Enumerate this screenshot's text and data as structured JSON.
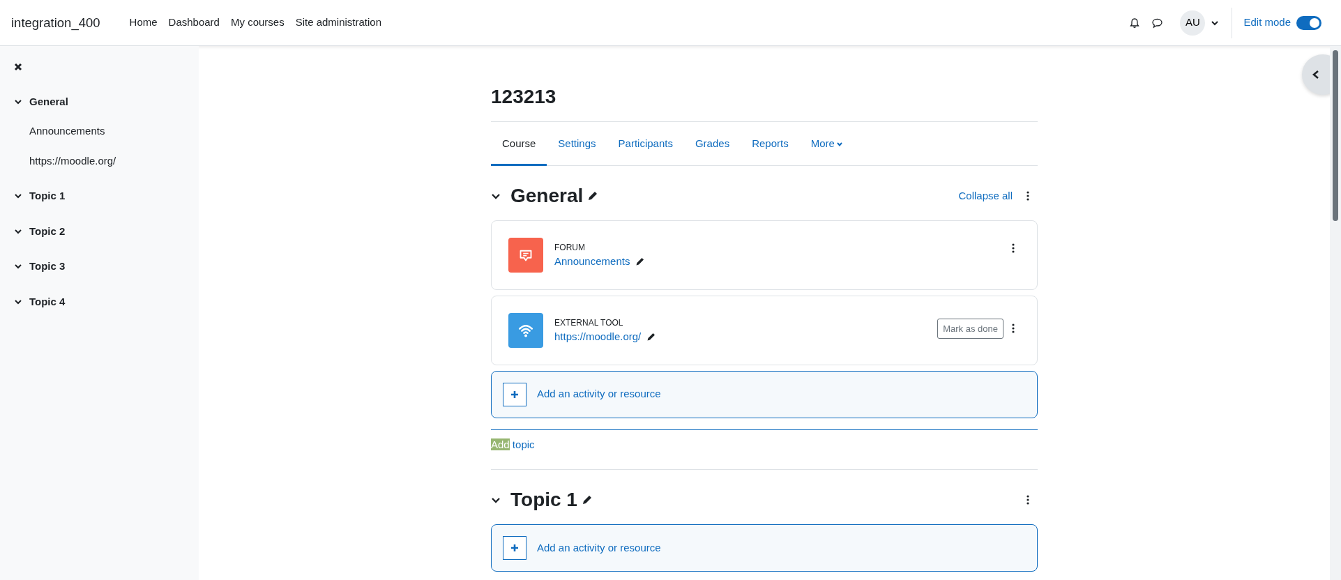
{
  "navbar": {
    "brand": "integration_400",
    "links": [
      "Home",
      "Dashboard",
      "My courses",
      "Site administration"
    ],
    "avatar": "AU",
    "edit_mode": {
      "label": "Edit mode",
      "on": true
    }
  },
  "sidebar": {
    "sections": [
      {
        "title": "General",
        "expanded": true,
        "children": [
          {
            "label": "Announcements"
          },
          {
            "label": "https://moodle.org/"
          }
        ]
      },
      {
        "title": "Topic 1",
        "expanded": true
      },
      {
        "title": "Topic 2",
        "expanded": true
      },
      {
        "title": "Topic 3",
        "expanded": true
      },
      {
        "title": "Topic 4",
        "expanded": true
      }
    ]
  },
  "course": {
    "title": "123213",
    "tabs": [
      {
        "label": "Course",
        "selected": true,
        "kind": "link"
      },
      {
        "label": "Settings",
        "selected": false,
        "kind": "link"
      },
      {
        "label": "Participants",
        "selected": false,
        "kind": "link"
      },
      {
        "label": "Grades",
        "selected": false,
        "kind": "link"
      },
      {
        "label": "Reports",
        "selected": false,
        "kind": "link"
      },
      {
        "label": "More",
        "selected": false,
        "kind": "dropdown"
      }
    ],
    "sections": [
      {
        "title": "General",
        "collapse_all": "Collapse all",
        "activities": [
          {
            "kind": "forum",
            "type_label": "FORUM",
            "name": "Announcements",
            "color": "#f7634d"
          },
          {
            "kind": "lti",
            "type_label": "EXTERNAL TOOL",
            "name": "https://moodle.org/",
            "color": "#399be2",
            "action": "Mark as done"
          }
        ],
        "add_activity": "Add an activity or resource",
        "add_topic": {
          "highlight": "Add",
          "rest": "topic"
        }
      },
      {
        "title": "Topic 1",
        "add_activity": "Add an activity or resource"
      }
    ]
  }
}
